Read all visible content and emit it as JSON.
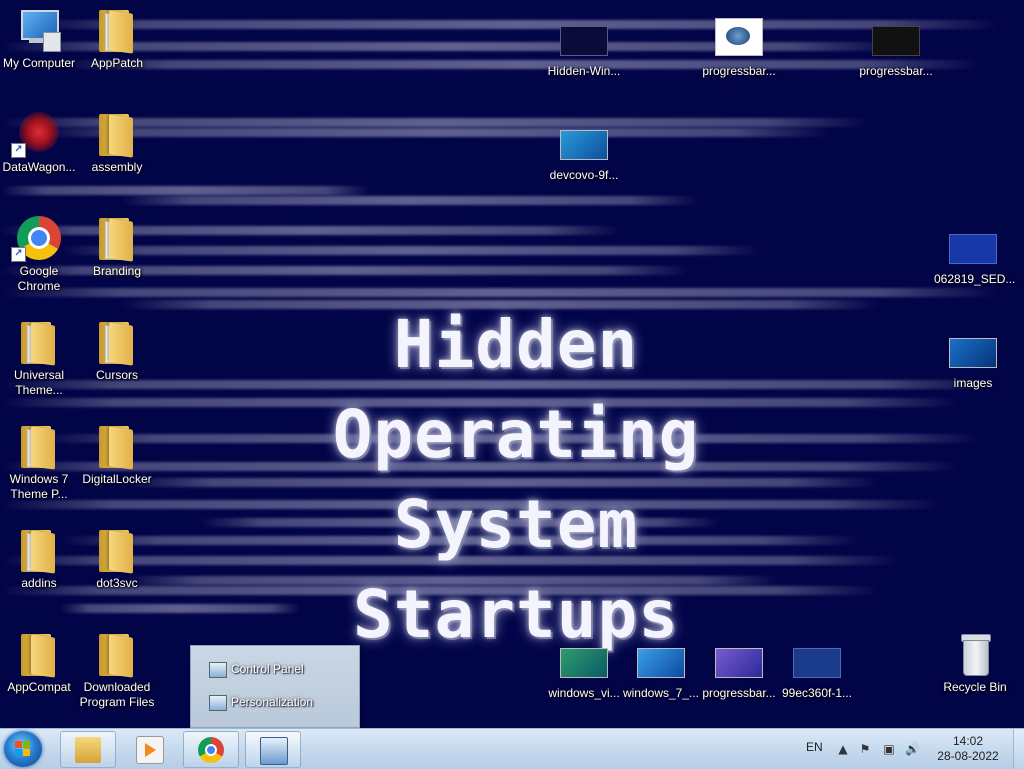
{
  "wallpaper": {
    "title_line1": "Hidden Operating",
    "title_line2": "System Startups"
  },
  "desktop_icons": {
    "my_computer": "My Computer",
    "apppatch": "AppPatch",
    "datawagon": "DataWagon...",
    "assembly": "assembly",
    "chrome": "Google Chrome",
    "branding": "Branding",
    "universal_theme": "Universal Theme...",
    "cursors": "Cursors",
    "win7_theme": "Windows 7 Theme P...",
    "digitallocker": "DigitalLocker",
    "addins": "addins",
    "dot3svc": "dot3svc",
    "appcompat": "AppCompat",
    "downloaded_program_files": "Downloaded Program Files",
    "hidden_win": "Hidden-Win...",
    "progressbar1": "progressbar...",
    "progressbar2": "progressbar...",
    "devcovo": "devcovo-9f...",
    "sed": "062819_SED...",
    "images": "images",
    "windows_vi": "windows_vi...",
    "windows_7": "windows_7_...",
    "progressbar3": "progressbar...",
    "hex_file": "99ec360f-1...",
    "recycle_bin": "Recycle Bin"
  },
  "jump_popup": {
    "item1": "Control Panel",
    "item2": "Personalization"
  },
  "taskbar": {
    "apps": [
      "start-button",
      "explorer",
      "media-player",
      "chrome",
      "control-panel"
    ],
    "language": "EN",
    "time": "14:02",
    "date": "28-08-2022"
  },
  "colors": {
    "wallpaper_bg": "#020448",
    "taskbar": "#c6daee",
    "wallpaper_text": "#f4f4ff"
  }
}
